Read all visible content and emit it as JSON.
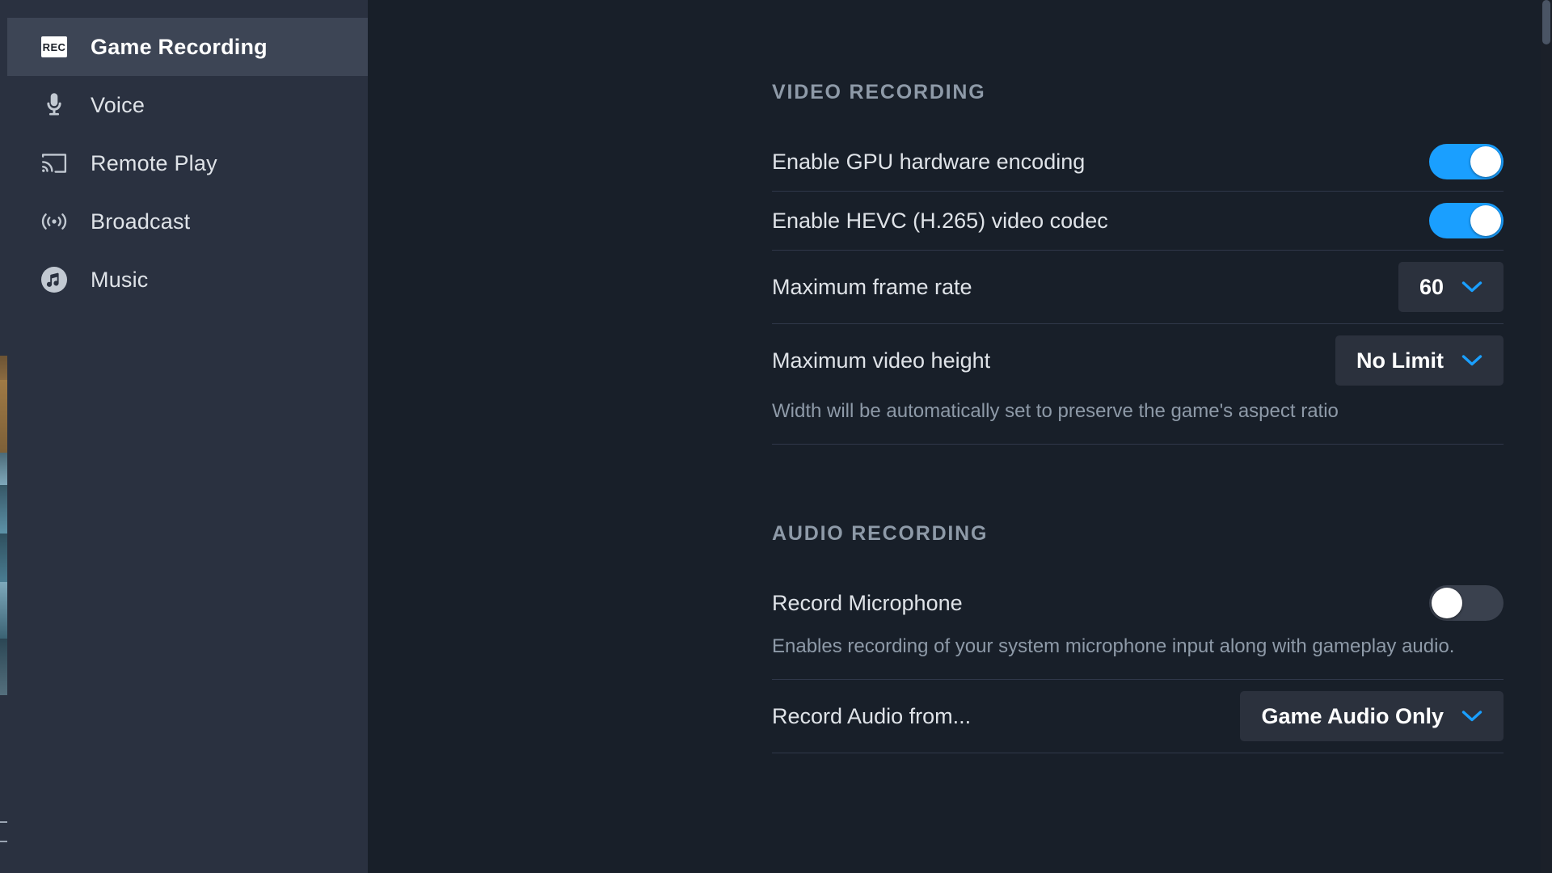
{
  "sidebar": {
    "items": [
      {
        "label": "Game Recording",
        "icon": "rec-badge-icon",
        "active": true
      },
      {
        "label": "Voice",
        "icon": "microphone-icon",
        "active": false
      },
      {
        "label": "Remote Play",
        "icon": "remote-play-cast-icon",
        "active": false
      },
      {
        "label": "Broadcast",
        "icon": "broadcast-signal-icon",
        "active": false
      },
      {
        "label": "Music",
        "icon": "music-note-icon",
        "active": false
      }
    ]
  },
  "main": {
    "video_section": {
      "title": "VIDEO RECORDING",
      "rows": [
        {
          "label": "Enable GPU hardware encoding",
          "control": "toggle",
          "state": "on"
        },
        {
          "label": "Enable HEVC (H.265) video codec",
          "control": "toggle",
          "state": "on"
        },
        {
          "label": "Maximum frame rate",
          "control": "dropdown",
          "value": "60"
        },
        {
          "label": "Maximum video height",
          "control": "dropdown",
          "value": "No Limit",
          "description": "Width will be automatically set to preserve the game's aspect ratio"
        }
      ]
    },
    "audio_section": {
      "title": "AUDIO RECORDING",
      "rows": [
        {
          "label": "Record Microphone",
          "control": "toggle",
          "state": "off",
          "description": "Enables recording of your system microphone input along with gameplay audio."
        },
        {
          "label": "Record Audio from...",
          "control": "dropdown",
          "value": "Game Audio Only"
        }
      ]
    }
  },
  "colors": {
    "accent_blue": "#1a9fff",
    "sidebar_bg": "#2a3140",
    "sidebar_active_bg": "#3d4555",
    "panel_bg": "#181f29",
    "control_bg": "#2b313d",
    "toggle_off_bg": "#3a414e",
    "muted_text": "#8e9aa8",
    "primary_text": "#dfe3e8"
  }
}
